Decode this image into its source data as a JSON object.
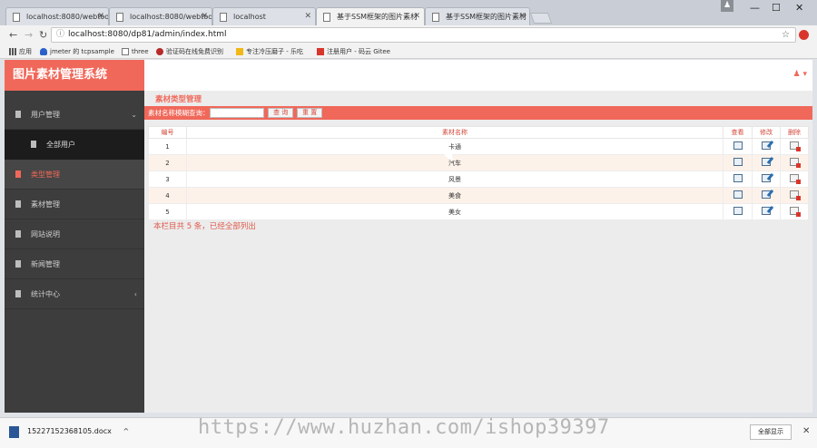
{
  "browser": {
    "tabs": [
      {
        "title": "localhost:8080/webtoo",
        "active": false
      },
      {
        "title": "localhost:8080/webtoo",
        "active": false
      },
      {
        "title": "localhost",
        "active": false
      },
      {
        "title": "基于SSM框架的图片素材",
        "active": true
      },
      {
        "title": "基于SSM框架的图片素材",
        "active": false
      }
    ],
    "url": "localhost:8080/dp81/admin/index.html",
    "bookmarks": [
      "应用",
      "jmeter 的 tcpsample",
      "three",
      "验证码在线免费识别",
      "专注冷压磨子 - 乐吃",
      "注册用户 - 码云 Gitee"
    ],
    "window_controls": {
      "minimize": "—",
      "maximize": "☐",
      "close": "✕"
    }
  },
  "app": {
    "brand": "图片素材管理系统",
    "sidebar": {
      "items": [
        {
          "label": "用户管理",
          "chevron": "⌄",
          "expanded": true
        },
        {
          "label": "类型管理",
          "active": true
        },
        {
          "label": "素材管理"
        },
        {
          "label": "网站说明"
        },
        {
          "label": "新闻管理"
        },
        {
          "label": "统计中心",
          "chevron": "‹"
        }
      ],
      "submenu": [
        {
          "label": "全部用户"
        }
      ]
    },
    "topbar": {
      "user_menu": "♟ ▾"
    },
    "section_title": "素材类型管理",
    "search": {
      "label": "素材名称模糊查询：",
      "input_value": "",
      "query_button": "查 询",
      "reset_button": "重 置"
    },
    "table": {
      "headers": [
        "编号",
        "素材名称",
        "查看",
        "修改",
        "删除"
      ],
      "rows": [
        {
          "id": "1",
          "name": "卡通"
        },
        {
          "id": "2",
          "name": "汽车"
        },
        {
          "id": "3",
          "name": "风景"
        },
        {
          "id": "4",
          "name": "美食"
        },
        {
          "id": "5",
          "name": "美女"
        }
      ]
    },
    "summary": "本栏目共 5 条，已经全部列出"
  },
  "downloads": {
    "file": "15227152368105.docx",
    "caret": "^",
    "show_all": "全部显示",
    "close": "✕"
  },
  "watermark": "https://www.huzhan.com/ishop39397",
  "colors": {
    "accent": "#f0685a",
    "sidebar": "#3d3d3d",
    "row_alt": "#fdf2ea"
  }
}
